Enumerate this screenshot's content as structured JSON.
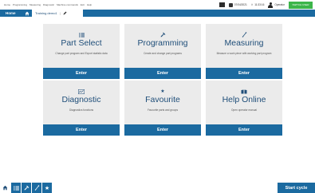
{
  "menubar": {
    "items": [
      "Home",
      "Programming",
      "Measuring",
      "Diagnostic",
      "Machine commands",
      "Exit",
      "Help"
    ],
    "date": "07/04/2021",
    "time": "11:33:16",
    "user": "Operator",
    "green_button": "SWITCH USER"
  },
  "nav": {
    "home": "Home",
    "crumb": "Training demo1"
  },
  "tiles": [
    {
      "title": "Part Select",
      "desc": "Change part program and Export statistic data",
      "enter": "Enter",
      "icon": "part-select-icon"
    },
    {
      "title": "Programming",
      "desc": "Create and change part programs",
      "enter": "Enter",
      "icon": "programming-icon"
    },
    {
      "title": "Measuring",
      "desc": "Measure a work piece with working part program",
      "enter": "Enter",
      "icon": "measuring-icon"
    },
    {
      "title": "Diagnostic",
      "desc": "Diagnostics functions",
      "enter": "Enter",
      "icon": "diagnostic-icon"
    },
    {
      "title": "Favourite",
      "desc": "Favourite parts and groups",
      "enter": "Enter",
      "icon": "star-icon"
    },
    {
      "title": "Help Online",
      "desc": "Open operator manual",
      "enter": "Enter",
      "icon": "help-icon"
    }
  ],
  "bottom": {
    "start_cycle": "Start cycle"
  },
  "colors": {
    "primary": "#1b6aa0",
    "tile_bg": "#ebebeb",
    "green": "#3cb54a"
  }
}
